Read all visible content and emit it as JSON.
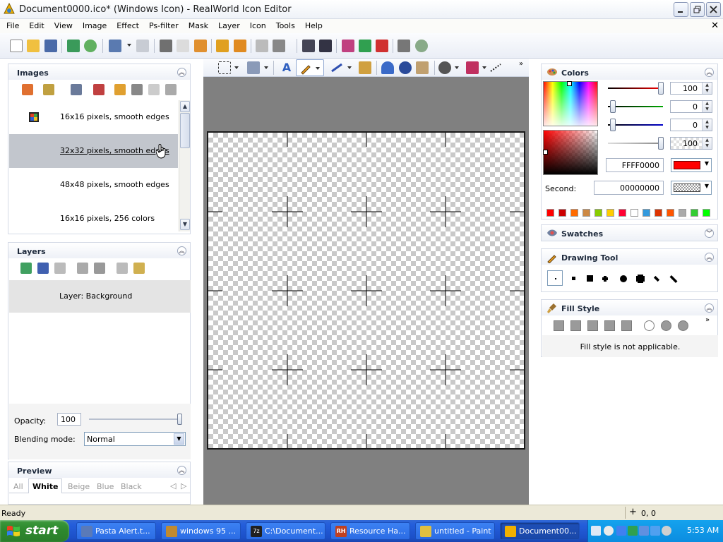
{
  "window": {
    "title": "Document0000.ico* (Windows Icon) - RealWorld Icon Editor"
  },
  "menu": [
    "File",
    "Edit",
    "View",
    "Image",
    "Effect",
    "Ps-filter",
    "Mask",
    "Layer",
    "Icon",
    "Tools",
    "Help"
  ],
  "images_panel": {
    "title": "Images",
    "items": [
      "16x16 pixels, smooth edges",
      "32x32 pixels, smooth edges",
      "48x48 pixels, smooth edges",
      "16x16 pixels, 256 colors"
    ]
  },
  "layers_panel": {
    "title": "Layers",
    "items": [
      "Layer: Background"
    ],
    "opacity_label": "Opacity:",
    "opacity_value": "100",
    "blending_label": "Blending mode:",
    "blending_value": "Normal"
  },
  "preview_panel": {
    "title": "Preview",
    "tabs": [
      "All",
      "White",
      "Beige",
      "Blue",
      "Black"
    ],
    "selected_tab": "White"
  },
  "colors_panel": {
    "title": "Colors",
    "red": "100",
    "green": "0",
    "blue": "0",
    "alpha": "100",
    "primary_hex": "FFFF0000",
    "second_label": "Second:",
    "second_hex": "00000000",
    "primary_color": "#ff0000",
    "palette": [
      "#ff0000",
      "#cc0000",
      "#ff6a00",
      "#cc8844",
      "#88cc00",
      "#ffcc00",
      "#ff0033",
      "#ffffff",
      "#3399dd",
      "#dd3300",
      "#ff5500",
      "#aaaaaa",
      "#33cc33",
      "#00ff00"
    ]
  },
  "swatches_panel": {
    "title": "Swatches"
  },
  "drawing_tool_panel": {
    "title": "Drawing Tool"
  },
  "fill_style_panel": {
    "title": "Fill Style",
    "message": "Fill style is not applicable."
  },
  "statusbar": {
    "status": "Ready",
    "coords": "0, 0"
  },
  "taskbar": {
    "start_label": "start",
    "tasks": [
      "Pasta Alert.t...",
      "windows 95 ...",
      "C:\\Document...",
      "Resource Ha...",
      "untitled - Paint",
      "Document00..."
    ],
    "active_task": "Document00...",
    "clock": "5:53 AM"
  }
}
